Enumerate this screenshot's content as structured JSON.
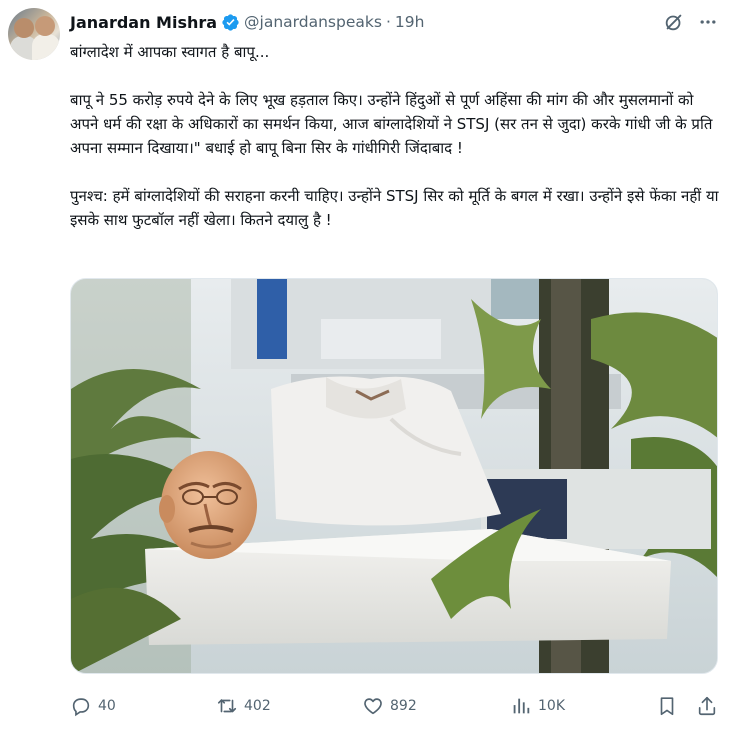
{
  "author": {
    "name": "Janardan Mishra",
    "handle": "@janardanspeaks",
    "separator": "·",
    "time": "19h",
    "verified": true
  },
  "tweet": {
    "line1": "बांग्लादेश में आपका स्वागत है बापू...",
    "para2": "बापू ने 55 करोड़ रुपये देने के लिए भूख हड़ताल किए। उन्होंने हिंदुओं से पूर्ण अहिंसा की मांग की और मुसलमानों को अपने धर्म की रक्षा के अधिकारों का समर्थन किया, आज बांग्लादेशियों ने STSJ (सर तन से जुदा) करके गांधी जी के प्रति अपना सम्मान दिखाया।\" बधाई हो बापू बिना सिर के गांधीगिरी जिंदाबाद !",
    "para3": "पुनश्च: हमें बांग्लादेशियों की सराहना करनी चाहिए। उन्होंने STSJ सिर को मूर्ति के बगल में रखा। उन्होंने इसे फेंका नहीं या इसके साथ फुटबॉल नहीं खेला। कितने दयालु है !"
  },
  "actions": {
    "replies": "40",
    "reposts": "402",
    "likes": "892",
    "views": "10K"
  },
  "icons": {
    "verified": "verified-badge-icon",
    "grok": "grok-icon",
    "more": "more-icon",
    "reply": "reply-icon",
    "repost": "repost-icon",
    "like": "heart-icon",
    "views": "views-icon",
    "bookmark": "bookmark-icon",
    "share": "share-icon"
  },
  "colors": {
    "text": "#0f1419",
    "secondary": "#536471",
    "verified": "#1d9bf0"
  }
}
